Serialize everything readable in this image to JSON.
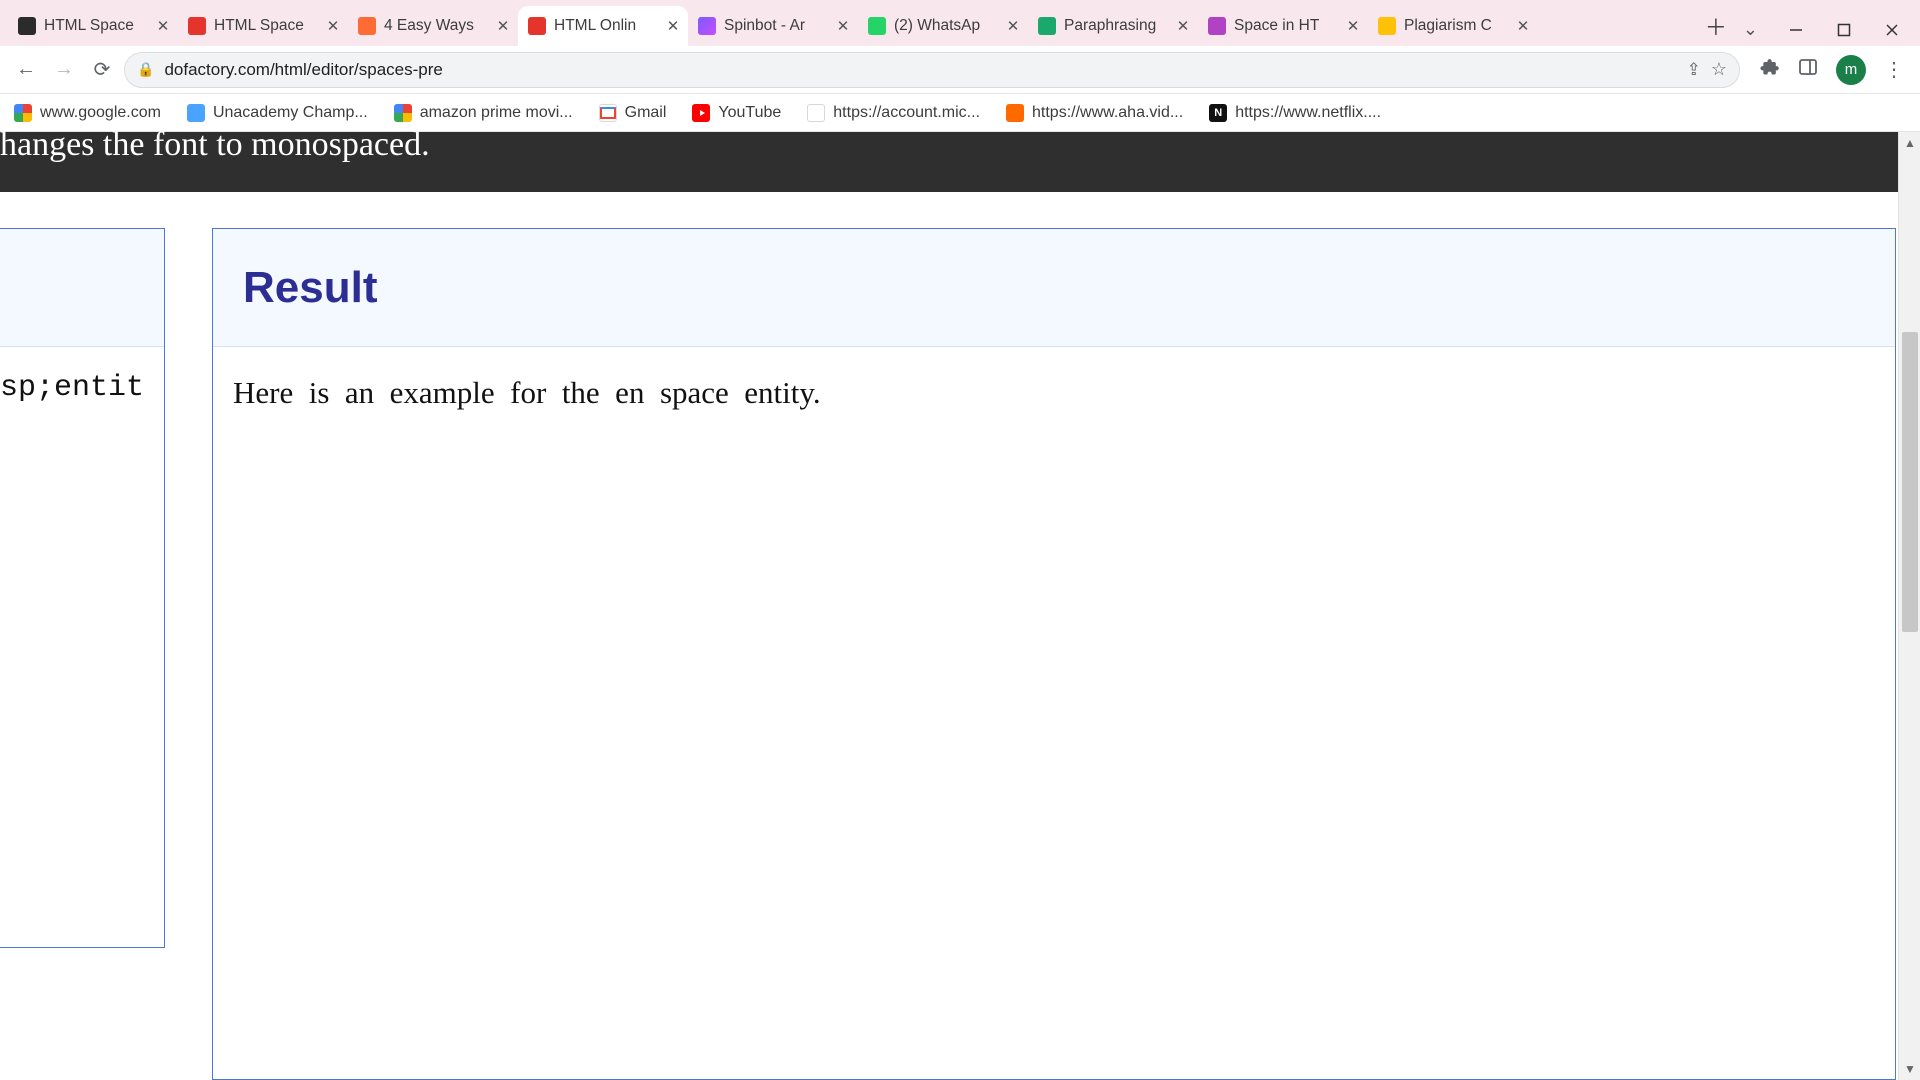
{
  "tabs": [
    {
      "title": "HTML Space",
      "active": false,
      "favclass": "fav-atom"
    },
    {
      "title": "HTML Space",
      "active": false,
      "favclass": "fav-do"
    },
    {
      "title": "4 Easy Ways",
      "active": false,
      "favclass": "fav-hs"
    },
    {
      "title": "HTML Onlin",
      "active": true,
      "favclass": "fav-do"
    },
    {
      "title": "Spinbot - Ar",
      "active": false,
      "favclass": "fav-spin"
    },
    {
      "title": "(2) WhatsAp",
      "active": false,
      "favclass": "fav-wa"
    },
    {
      "title": "Paraphrasing",
      "active": false,
      "favclass": "fav-quill"
    },
    {
      "title": "Space in HT",
      "active": false,
      "favclass": "fav-box"
    },
    {
      "title": "Plagiarism C",
      "active": false,
      "favclass": "fav-yel"
    }
  ],
  "omnibox": {
    "url": "dofactory.com/html/editor/spaces-pre"
  },
  "avatar_initial": "m",
  "bookmarks": [
    {
      "label": "www.google.com",
      "ico": "ico-g"
    },
    {
      "label": "Unacademy Champ...",
      "ico": "ico-un"
    },
    {
      "label": "amazon prime movi...",
      "ico": "ico-g"
    },
    {
      "label": "Gmail",
      "ico": "ico-gm"
    },
    {
      "label": "YouTube",
      "ico": "ico-yt"
    },
    {
      "label": "https://account.mic...",
      "ico": "ico-ms"
    },
    {
      "label": "https://www.aha.vid...",
      "ico": "ico-aha"
    },
    {
      "label": "https://www.netflix....",
      "ico": "ico-nf"
    }
  ],
  "dark_strip_text": "hanges the font to monospaced.",
  "left_code_fragment": "sp;entit",
  "result": {
    "heading": "Result",
    "paragraph": "Here is an example for the en space entity."
  }
}
